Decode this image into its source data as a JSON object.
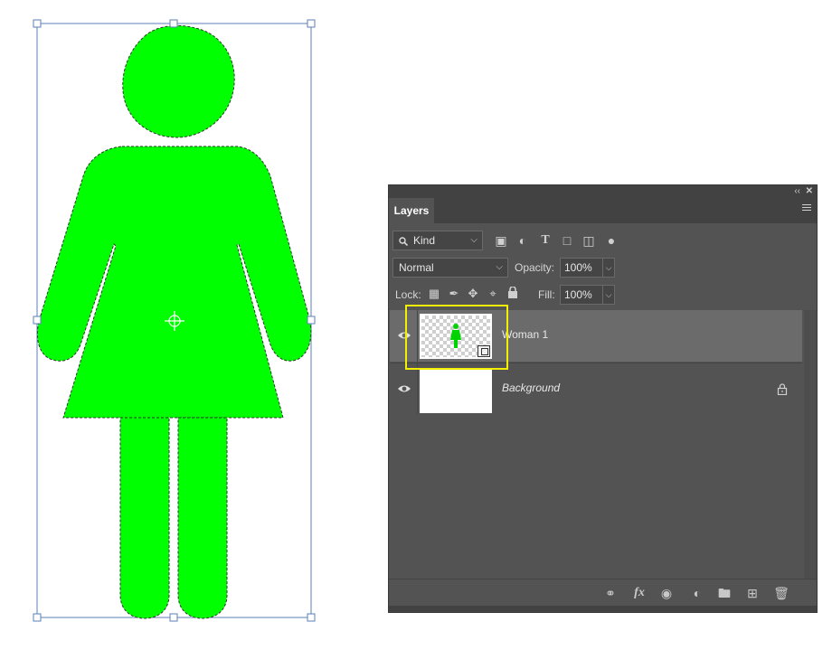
{
  "canvas": {
    "figure_color": "#00ff00",
    "bounding_box_color": "#5b7fb5"
  },
  "panel": {
    "title": "Layers",
    "collapse_glyph": "‹‹",
    "close_glyph": "✕"
  },
  "filter": {
    "kind_label": "Kind",
    "icons": [
      "image-filter-icon",
      "adjustment-filter-icon",
      "type-filter-icon",
      "shape-filter-icon",
      "smart-object-filter-icon",
      "filter-toggle-icon"
    ]
  },
  "blend": {
    "mode": "Normal",
    "opacity_label": "Opacity:",
    "opacity_value": "100%"
  },
  "lock": {
    "label": "Lock:",
    "fill_label": "Fill:",
    "fill_value": "100%",
    "icons": [
      "lock-transparent-pixels-icon",
      "lock-image-pixels-icon",
      "lock-position-icon",
      "lock-artboard-icon",
      "lock-all-icon"
    ]
  },
  "layers": [
    {
      "name": "Woman 1",
      "selected": true,
      "visible": true,
      "smart_object": true,
      "locked": false
    },
    {
      "name": "Background",
      "selected": false,
      "visible": true,
      "smart_object": false,
      "locked": true
    }
  ],
  "footer_icons": [
    "link-layers-icon",
    "layer-style-fx-icon",
    "add-mask-icon",
    "adjustment-layer-icon",
    "new-group-icon",
    "new-layer-icon",
    "delete-layer-icon"
  ],
  "colors": {
    "panel_bg": "#535353",
    "selected_layer": "#6b6b6b",
    "highlight": "#f0f000"
  }
}
